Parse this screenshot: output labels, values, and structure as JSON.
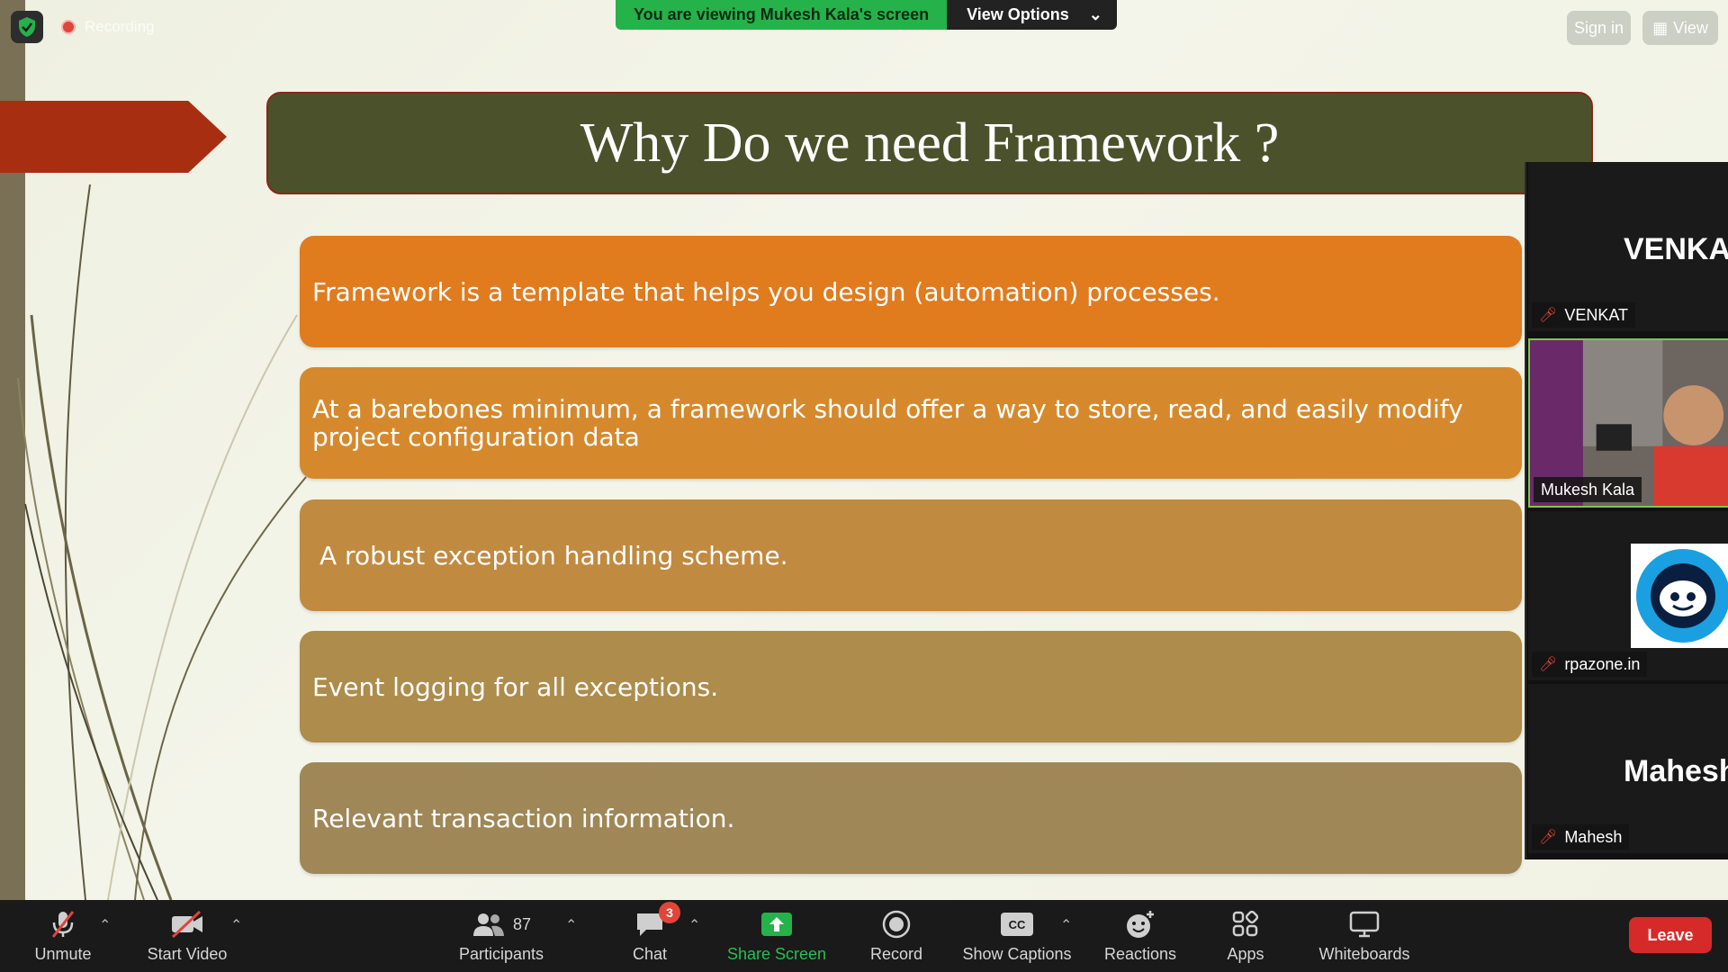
{
  "banner": {
    "message": "You are viewing Mukesh Kala's screen",
    "options": "View Options"
  },
  "recording": {
    "label": "Recording"
  },
  "topbar": {
    "signin": "Sign in",
    "view": "View"
  },
  "slide": {
    "title": "Why Do we need Framework ?",
    "bullets": [
      "Framework is a template that helps you design (automation) processes.",
      "At a barebones minimum, a framework should offer a way to store, read, and easily modify project configuration data",
      "A robust exception handling scheme.",
      "Event logging for all exceptions.",
      "Relevant transaction information."
    ]
  },
  "participants_panel": [
    {
      "display": "VENKAT",
      "name": "VENKAT",
      "muted": true
    },
    {
      "display": "",
      "name": "Mukesh Kala",
      "muted": false
    },
    {
      "display": "",
      "name": "rpazone.in",
      "muted": true
    },
    {
      "display": "Mahesh",
      "name": "Mahesh",
      "muted": true
    }
  ],
  "toolbar": {
    "unmute": "Unmute",
    "start_video": "Start Video",
    "participants": "Participants",
    "participants_count": "87",
    "chat": "Chat",
    "chat_badge": "3",
    "share_screen": "Share Screen",
    "record": "Record",
    "show_captions": "Show Captions",
    "reactions": "Reactions",
    "apps": "Apps",
    "whiteboards": "Whiteboards",
    "leave": "Leave"
  },
  "colors": {
    "accent_green": "#25b24a",
    "leave_red": "#d62a2a",
    "title_bg": "#4b522b",
    "bullet_1": "#e07b1e",
    "bullet_5": "#a08758"
  }
}
